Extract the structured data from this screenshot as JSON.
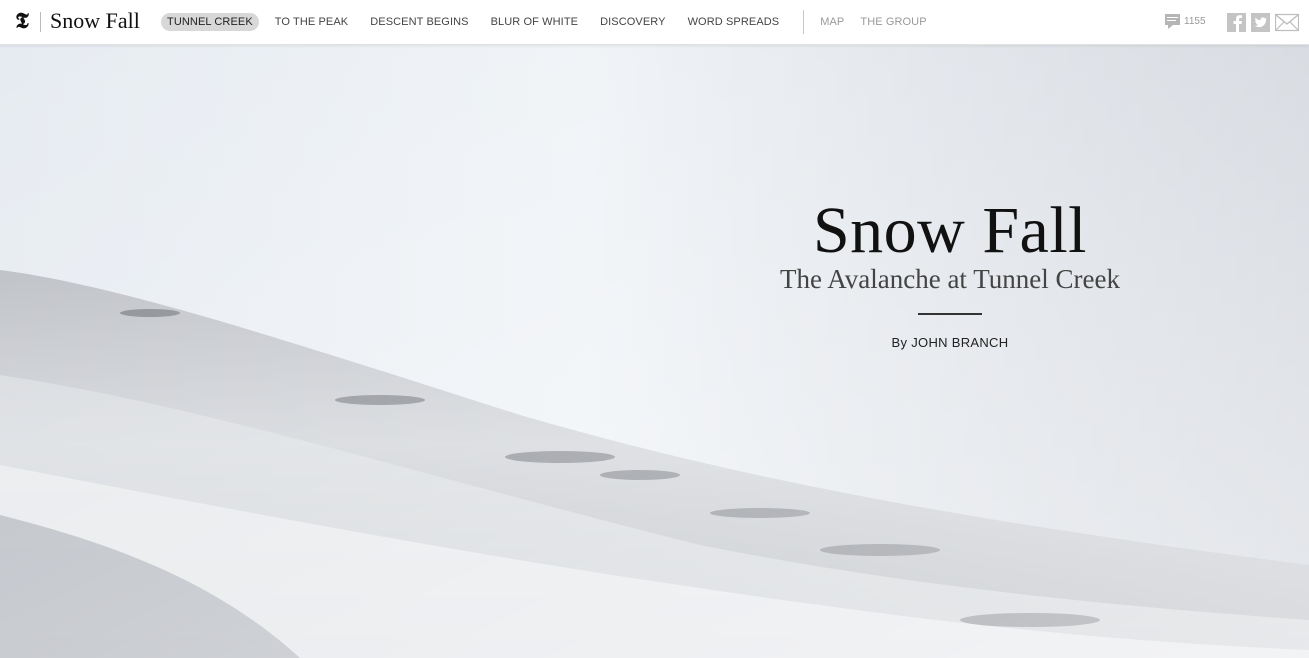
{
  "header": {
    "logo_glyph": "𝕿",
    "story_title": "Snow Fall",
    "nav": [
      {
        "label": "TUNNEL CREEK",
        "active": true
      },
      {
        "label": "TO THE PEAK",
        "active": false
      },
      {
        "label": "DESCENT BEGINS",
        "active": false
      },
      {
        "label": "BLUR OF WHITE",
        "active": false
      },
      {
        "label": "DISCOVERY",
        "active": false
      },
      {
        "label": "WORD SPREADS",
        "active": false
      }
    ],
    "secondary_nav": [
      {
        "label": "MAP"
      },
      {
        "label": "THE GROUP"
      }
    ],
    "comments": {
      "icon": "comment-icon",
      "count": "1155"
    },
    "share": [
      {
        "icon": "facebook-icon"
      },
      {
        "icon": "twitter-icon"
      },
      {
        "icon": "email-icon"
      }
    ]
  },
  "hero": {
    "title": "Snow Fall",
    "subtitle": "The Avalanche at Tunnel Creek",
    "byline": "By JOHN BRANCH"
  },
  "colors": {
    "active_tab_bg": "#d8d8d8",
    "nav_text": "#444444",
    "secondary_nav_text": "#999999",
    "icon_gray": "#b5b5b5"
  }
}
